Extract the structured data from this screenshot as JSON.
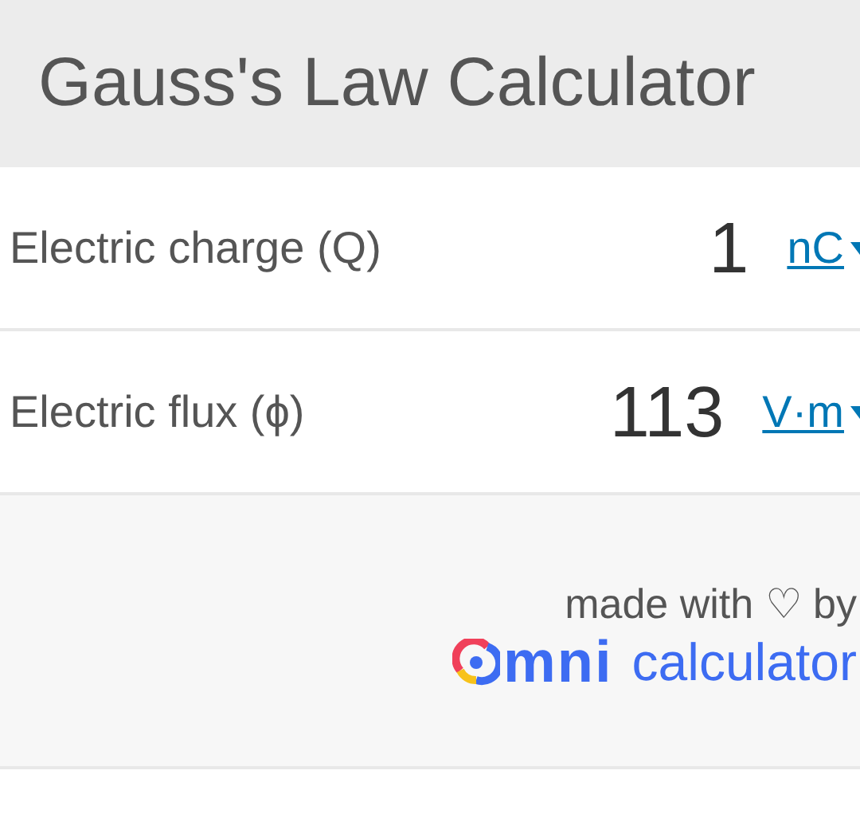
{
  "title": "Gauss's Law Calculator",
  "fields": [
    {
      "label": "Electric charge (Q)",
      "value": "1",
      "unit": "nC"
    },
    {
      "label": "Electric flux (ϕ)",
      "value": "113",
      "unit": "V·m"
    }
  ],
  "footer": {
    "credit": "made with ♡ by",
    "logo_text": "mni",
    "logo_suffix": "calculator"
  }
}
